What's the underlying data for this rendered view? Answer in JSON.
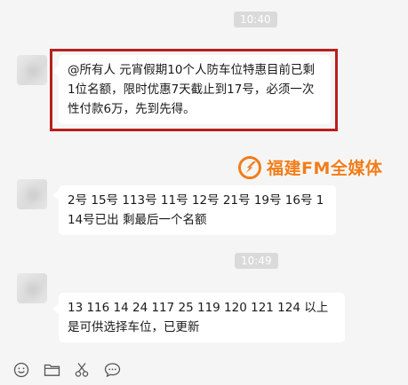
{
  "timestamps": [
    "10:40",
    "10:49"
  ],
  "messages": [
    {
      "text": "@所有人 元宵假期10个人防车位特惠目前已剩1位名额，限时优惠7天截止到17号，必须一次性付款6万，先到先得。"
    },
    {
      "text": "2号 15号 113号 11号 12号 21号 19号 16号 114号已出 剩最后一个名额"
    },
    {
      "text": "13   116 14 24 117   25  119  120  121 124 以上是可供选择车位，已更新"
    }
  ],
  "watermark": {
    "text": "福建FM全媒体"
  },
  "toolbar": {
    "icons": [
      "emoji-icon",
      "folder-icon",
      "scissors-icon",
      "chat-bubble-icon"
    ]
  },
  "colors": {
    "background": "#f5f5f5",
    "highlight": "#b81f1f",
    "watermark": "#f07d1a"
  }
}
